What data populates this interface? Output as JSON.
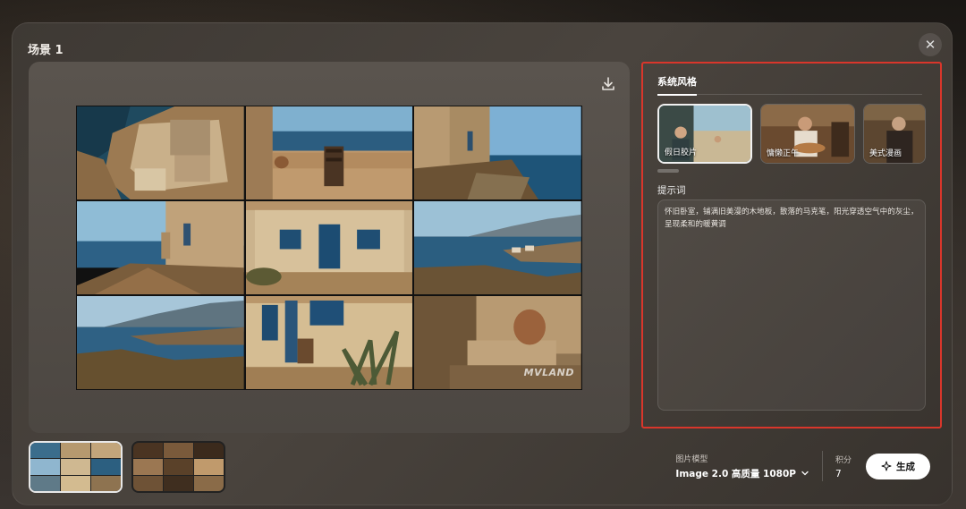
{
  "modal": {
    "title": "场景 1",
    "close_icon": "close-icon"
  },
  "preview": {
    "download_icon": "download-icon",
    "watermark": "MVLAND",
    "grid_scenes": [
      "aerial-coastal-house",
      "terrace-chair-sea",
      "stone-house-cliff",
      "house-window-sea",
      "stone-house-blue-door",
      "coastline-village",
      "bay-landscape",
      "house-blue-shutters-agave",
      "terrace-pot-bench"
    ]
  },
  "thumbnails": [
    {
      "name": "thumbnail-1",
      "active": true
    },
    {
      "name": "thumbnail-2",
      "active": false
    }
  ],
  "right_panel": {
    "tab_label": "系统风格",
    "styles": [
      {
        "label": "假日胶片",
        "selected": true
      },
      {
        "label": "慵懒正午",
        "selected": false
      },
      {
        "label": "美式漫画",
        "selected": false
      }
    ],
    "prompt_title": "提示词",
    "prompt_text": "怀旧卧室，铺满旧美漫的木地板，散落的马克笔，阳光穿透空气中的灰尘，呈现柔和的暖黄调"
  },
  "bottom_bar": {
    "model_label": "图片模型",
    "model_value": "Image 2.0 高质量  1080P",
    "credits_label": "积分",
    "credits_value": "7",
    "generate_label": "生成"
  },
  "colors": {
    "highlight_border": "#d9362b",
    "button_bg": "#ffffff"
  }
}
